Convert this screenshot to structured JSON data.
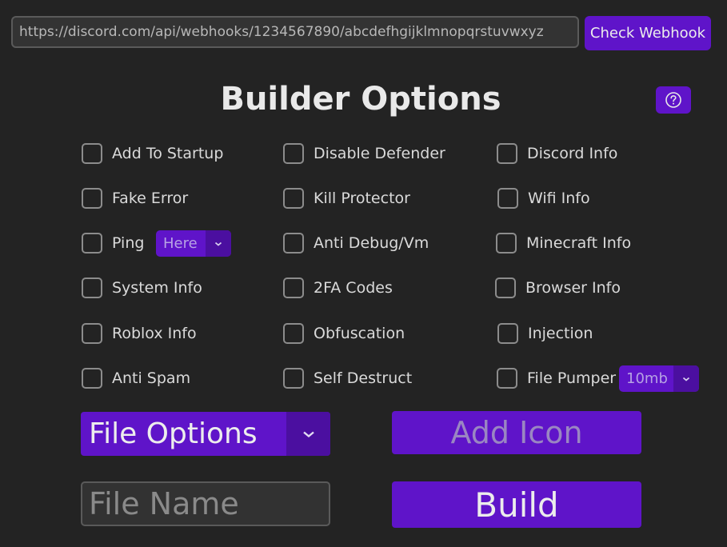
{
  "webhook": {
    "url_value": "https://discord.com/api/webhooks/1234567890/abcdefhgijklmnopqrstuvwxyz",
    "check_label": "Check Webhook"
  },
  "title": "Builder Options",
  "help_icon": "question-circle-icon",
  "options": {
    "add_to_startup": "Add To Startup",
    "disable_defender": "Disable Defender",
    "discord_info": "Discord Info",
    "fake_error": "Fake Error",
    "kill_protector": "Kill Protector",
    "wifi_info": "Wifi Info",
    "ping": "Ping",
    "anti_debug": "Anti Debug/Vm",
    "minecraft_info": "Minecraft Info",
    "system_info": "System Info",
    "twofa_codes": "2FA Codes",
    "browser_info": "Browser Info",
    "roblox_info": "Roblox Info",
    "obfuscation": "Obfuscation",
    "injection": "Injection",
    "anti_spam": "Anti Spam",
    "self_destruct": "Self Destruct",
    "file_pumper": "File Pumper"
  },
  "ping_select": {
    "value": "Here"
  },
  "pumper_select": {
    "value": "10mb"
  },
  "file_options": {
    "value": "File Options"
  },
  "add_icon_label": "Add Icon",
  "file_name": {
    "placeholder": "File Name"
  },
  "build_label": "Build",
  "colors": {
    "background": "#232323",
    "accent": "#5f14c9",
    "accent_dark": "#4b0fa0"
  }
}
